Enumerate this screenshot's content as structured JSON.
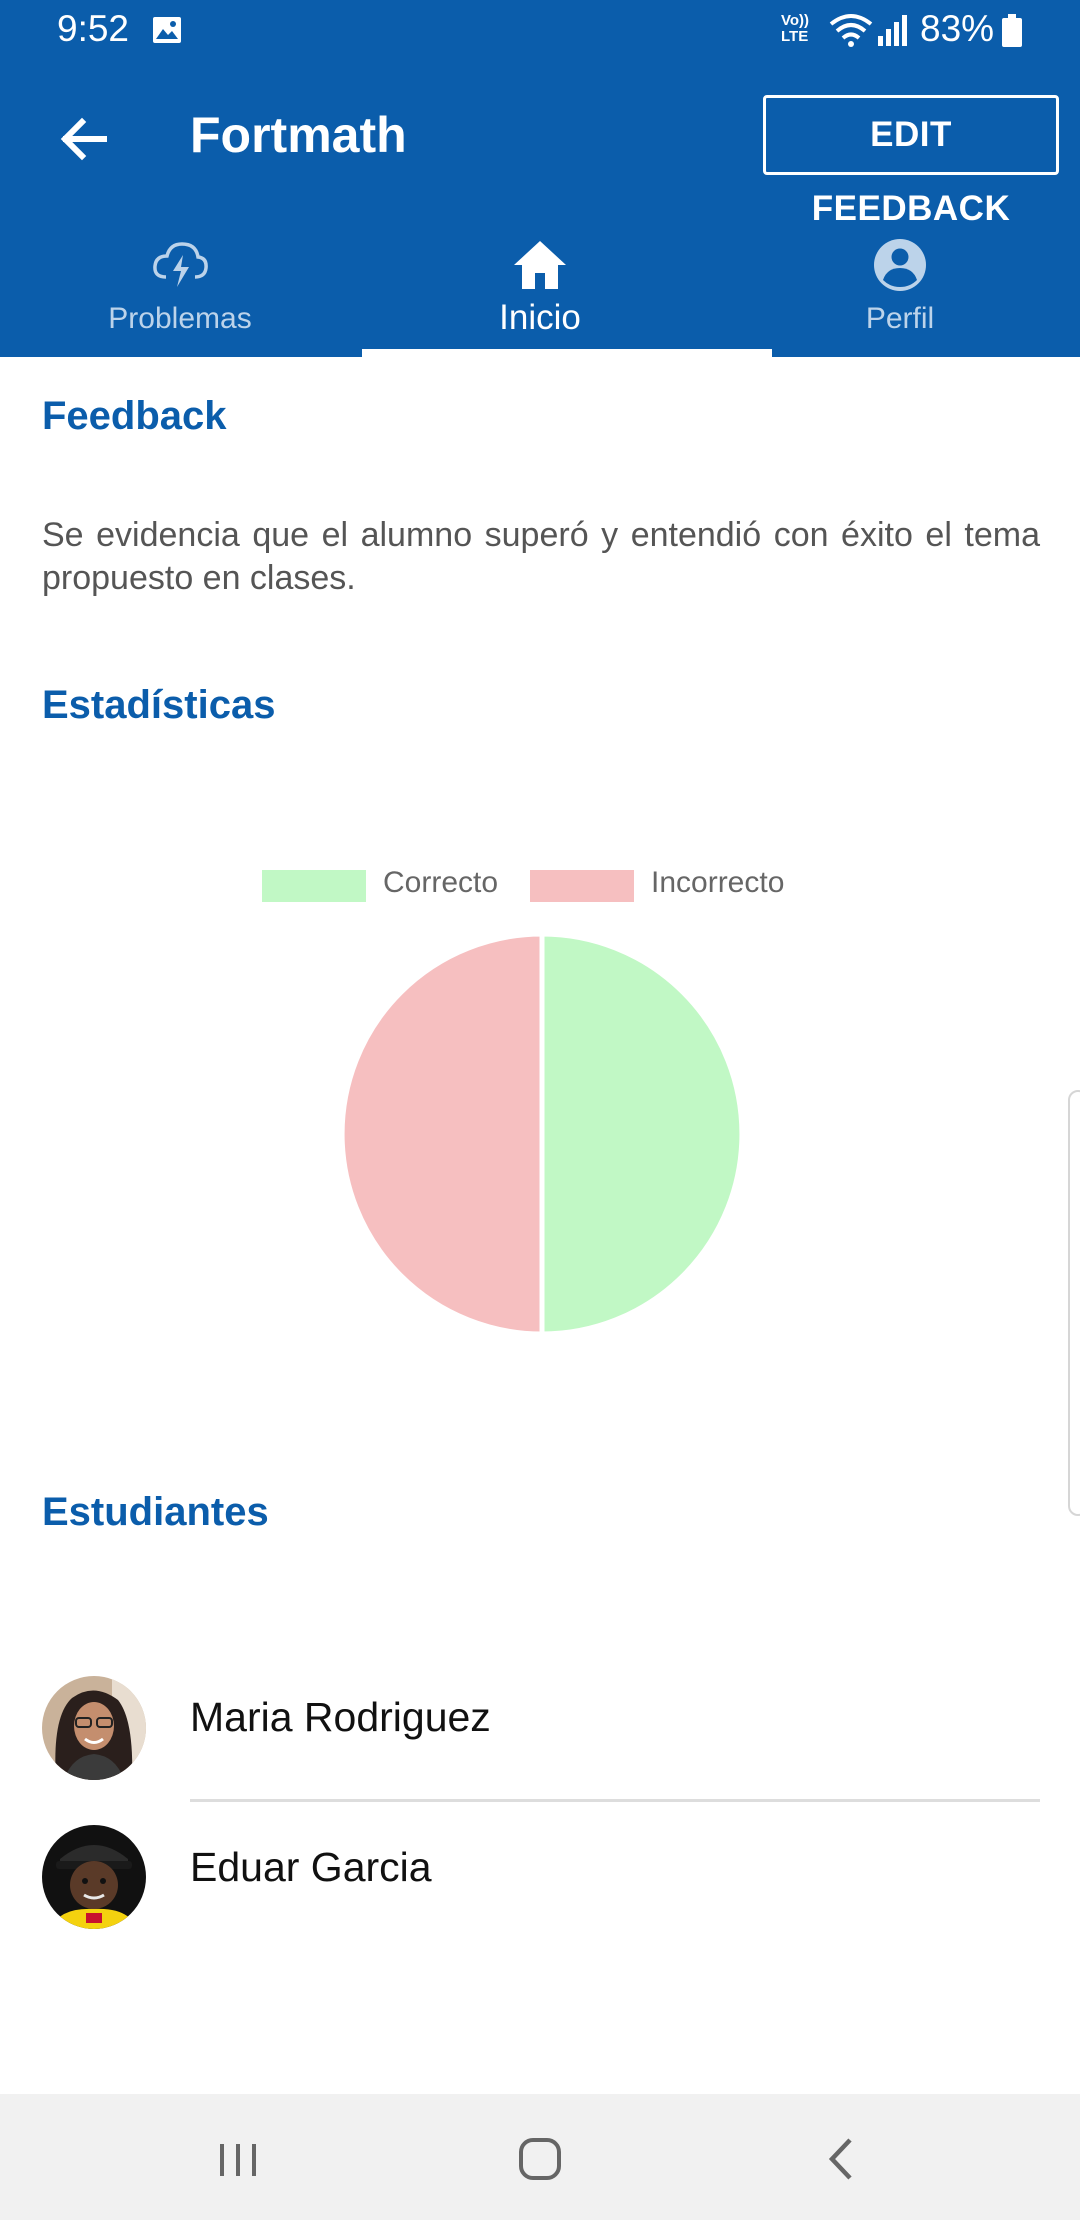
{
  "status_bar": {
    "time": "9:52",
    "network_label": "Vo)) LTE",
    "battery_percent": "83%"
  },
  "toolbar": {
    "title": "Fortmath",
    "edit_button_label": "EDIT FEEDBACK"
  },
  "tabs": [
    {
      "label": "Problemas",
      "icon": "lightning-cloud-icon",
      "active": false
    },
    {
      "label": "Inicio",
      "icon": "home-icon",
      "active": true
    },
    {
      "label": "Perfil",
      "icon": "account-circle-icon",
      "active": false
    }
  ],
  "feedback": {
    "heading": "Feedback",
    "text": "Se evidencia que el alumno superó y entendió con éxito el tema propuesto en clases."
  },
  "statistics": {
    "heading": "Estadísticas"
  },
  "chart_data": {
    "type": "pie",
    "categories": [
      "Correcto",
      "Incorrecto"
    ],
    "values": [
      50,
      50
    ],
    "colors": [
      "#c1f8c5",
      "#f6bfc0"
    ],
    "legend_position": "top"
  },
  "students": {
    "heading": "Estudiantes",
    "items": [
      {
        "name": "Maria Rodriguez"
      },
      {
        "name": "Eduar Garcia"
      }
    ]
  },
  "colors": {
    "primary": "#0b5dab",
    "correct": "#c1f8c5",
    "incorrect": "#f6bfc0"
  }
}
